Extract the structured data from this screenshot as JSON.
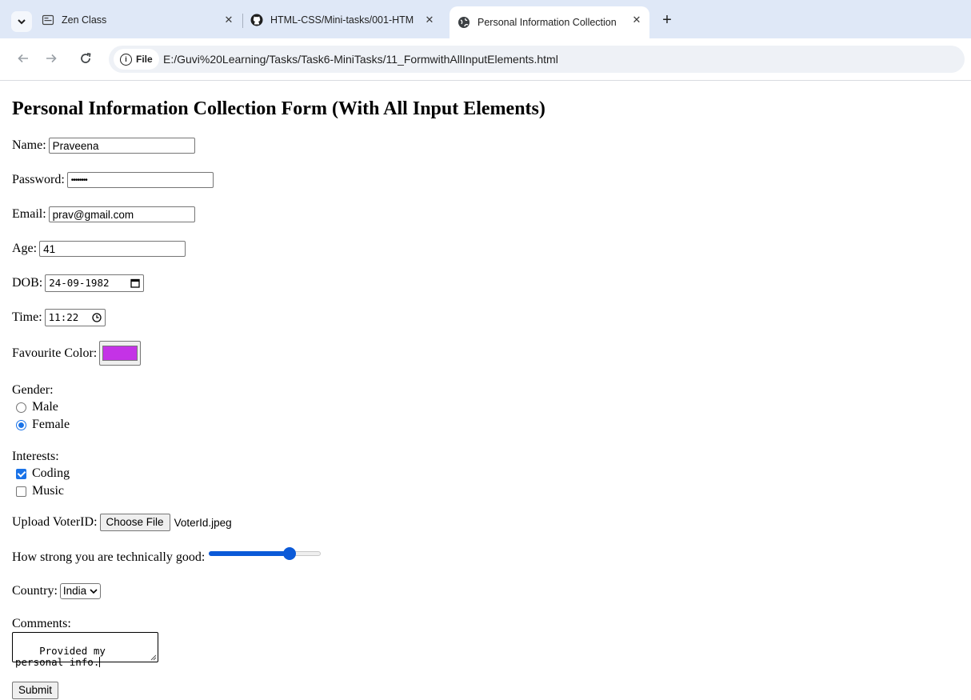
{
  "browser": {
    "tabs": [
      {
        "label": "Zen Class",
        "icon": "zen-class-favicon",
        "active": false
      },
      {
        "label": "HTML-CSS/Mini-tasks/001-HTM",
        "icon": "github-icon",
        "active": false
      },
      {
        "label": "Personal Information Collection",
        "icon": "globe-icon",
        "active": true
      }
    ],
    "tab_close": "✕",
    "new_tab": "+",
    "chip_label": "File",
    "url": "E:/Guvi%20Learning/Tasks/Task6-MiniTasks/11_FormwithAllInputElements.html"
  },
  "page": {
    "title": "Personal Information Collection Form (With All Input Elements)",
    "name": {
      "label": "Name:",
      "value": "Praveena"
    },
    "password": {
      "label": "Password:",
      "value": "••••••••"
    },
    "email": {
      "label": "Email:",
      "value": "prav@gmail.com"
    },
    "age": {
      "label": "Age:",
      "value": "41"
    },
    "dob": {
      "label": "DOB:",
      "value": "24-09-1982"
    },
    "time": {
      "label": "Time:",
      "value": "11:22"
    },
    "color": {
      "label": "Favourite Color:",
      "value": "#c433e6"
    },
    "gender": {
      "label": "Gender:",
      "options": [
        {
          "label": "Male",
          "checked": false
        },
        {
          "label": "Female",
          "checked": true
        }
      ]
    },
    "interests": {
      "label": "Interests:",
      "options": [
        {
          "label": "Coding",
          "checked": true
        },
        {
          "label": "Music",
          "checked": false
        }
      ]
    },
    "upload": {
      "label": "Upload VoterID:",
      "button": "Choose File",
      "file": "VoterId.jpeg"
    },
    "skill": {
      "label": "How strong you are technically good:",
      "value_fraction": 0.72
    },
    "country": {
      "label": "Country:",
      "value": "India"
    },
    "comments": {
      "label": "Comments:",
      "value": "Provided my personal info."
    },
    "submit": "Submit"
  },
  "colors": {
    "accent": "#1a73e8",
    "tab_bar": "#dfe8f7"
  }
}
